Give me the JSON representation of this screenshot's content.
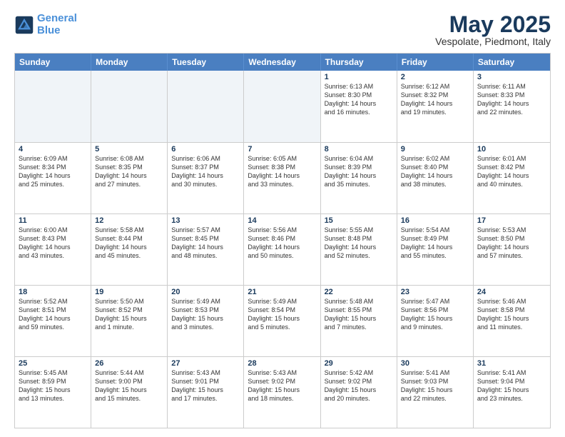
{
  "logo": {
    "line1": "General",
    "line2": "Blue"
  },
  "title": "May 2025",
  "location": "Vespolate, Piedmont, Italy",
  "header_days": [
    "Sunday",
    "Monday",
    "Tuesday",
    "Wednesday",
    "Thursday",
    "Friday",
    "Saturday"
  ],
  "rows": [
    [
      {
        "day": "",
        "info": "",
        "empty": true
      },
      {
        "day": "",
        "info": "",
        "empty": true
      },
      {
        "day": "",
        "info": "",
        "empty": true
      },
      {
        "day": "",
        "info": "",
        "empty": true
      },
      {
        "day": "1",
        "info": "Sunrise: 6:13 AM\nSunset: 8:30 PM\nDaylight: 14 hours\nand 16 minutes."
      },
      {
        "day": "2",
        "info": "Sunrise: 6:12 AM\nSunset: 8:32 PM\nDaylight: 14 hours\nand 19 minutes."
      },
      {
        "day": "3",
        "info": "Sunrise: 6:11 AM\nSunset: 8:33 PM\nDaylight: 14 hours\nand 22 minutes."
      }
    ],
    [
      {
        "day": "4",
        "info": "Sunrise: 6:09 AM\nSunset: 8:34 PM\nDaylight: 14 hours\nand 25 minutes."
      },
      {
        "day": "5",
        "info": "Sunrise: 6:08 AM\nSunset: 8:35 PM\nDaylight: 14 hours\nand 27 minutes."
      },
      {
        "day": "6",
        "info": "Sunrise: 6:06 AM\nSunset: 8:37 PM\nDaylight: 14 hours\nand 30 minutes."
      },
      {
        "day": "7",
        "info": "Sunrise: 6:05 AM\nSunset: 8:38 PM\nDaylight: 14 hours\nand 33 minutes."
      },
      {
        "day": "8",
        "info": "Sunrise: 6:04 AM\nSunset: 8:39 PM\nDaylight: 14 hours\nand 35 minutes."
      },
      {
        "day": "9",
        "info": "Sunrise: 6:02 AM\nSunset: 8:40 PM\nDaylight: 14 hours\nand 38 minutes."
      },
      {
        "day": "10",
        "info": "Sunrise: 6:01 AM\nSunset: 8:42 PM\nDaylight: 14 hours\nand 40 minutes."
      }
    ],
    [
      {
        "day": "11",
        "info": "Sunrise: 6:00 AM\nSunset: 8:43 PM\nDaylight: 14 hours\nand 43 minutes."
      },
      {
        "day": "12",
        "info": "Sunrise: 5:58 AM\nSunset: 8:44 PM\nDaylight: 14 hours\nand 45 minutes."
      },
      {
        "day": "13",
        "info": "Sunrise: 5:57 AM\nSunset: 8:45 PM\nDaylight: 14 hours\nand 48 minutes."
      },
      {
        "day": "14",
        "info": "Sunrise: 5:56 AM\nSunset: 8:46 PM\nDaylight: 14 hours\nand 50 minutes."
      },
      {
        "day": "15",
        "info": "Sunrise: 5:55 AM\nSunset: 8:48 PM\nDaylight: 14 hours\nand 52 minutes."
      },
      {
        "day": "16",
        "info": "Sunrise: 5:54 AM\nSunset: 8:49 PM\nDaylight: 14 hours\nand 55 minutes."
      },
      {
        "day": "17",
        "info": "Sunrise: 5:53 AM\nSunset: 8:50 PM\nDaylight: 14 hours\nand 57 minutes."
      }
    ],
    [
      {
        "day": "18",
        "info": "Sunrise: 5:52 AM\nSunset: 8:51 PM\nDaylight: 14 hours\nand 59 minutes."
      },
      {
        "day": "19",
        "info": "Sunrise: 5:50 AM\nSunset: 8:52 PM\nDaylight: 15 hours\nand 1 minute."
      },
      {
        "day": "20",
        "info": "Sunrise: 5:49 AM\nSunset: 8:53 PM\nDaylight: 15 hours\nand 3 minutes."
      },
      {
        "day": "21",
        "info": "Sunrise: 5:49 AM\nSunset: 8:54 PM\nDaylight: 15 hours\nand 5 minutes."
      },
      {
        "day": "22",
        "info": "Sunrise: 5:48 AM\nSunset: 8:55 PM\nDaylight: 15 hours\nand 7 minutes."
      },
      {
        "day": "23",
        "info": "Sunrise: 5:47 AM\nSunset: 8:56 PM\nDaylight: 15 hours\nand 9 minutes."
      },
      {
        "day": "24",
        "info": "Sunrise: 5:46 AM\nSunset: 8:58 PM\nDaylight: 15 hours\nand 11 minutes."
      }
    ],
    [
      {
        "day": "25",
        "info": "Sunrise: 5:45 AM\nSunset: 8:59 PM\nDaylight: 15 hours\nand 13 minutes."
      },
      {
        "day": "26",
        "info": "Sunrise: 5:44 AM\nSunset: 9:00 PM\nDaylight: 15 hours\nand 15 minutes."
      },
      {
        "day": "27",
        "info": "Sunrise: 5:43 AM\nSunset: 9:01 PM\nDaylight: 15 hours\nand 17 minutes."
      },
      {
        "day": "28",
        "info": "Sunrise: 5:43 AM\nSunset: 9:02 PM\nDaylight: 15 hours\nand 18 minutes."
      },
      {
        "day": "29",
        "info": "Sunrise: 5:42 AM\nSunset: 9:02 PM\nDaylight: 15 hours\nand 20 minutes."
      },
      {
        "day": "30",
        "info": "Sunrise: 5:41 AM\nSunset: 9:03 PM\nDaylight: 15 hours\nand 22 minutes."
      },
      {
        "day": "31",
        "info": "Sunrise: 5:41 AM\nSunset: 9:04 PM\nDaylight: 15 hours\nand 23 minutes."
      }
    ]
  ]
}
